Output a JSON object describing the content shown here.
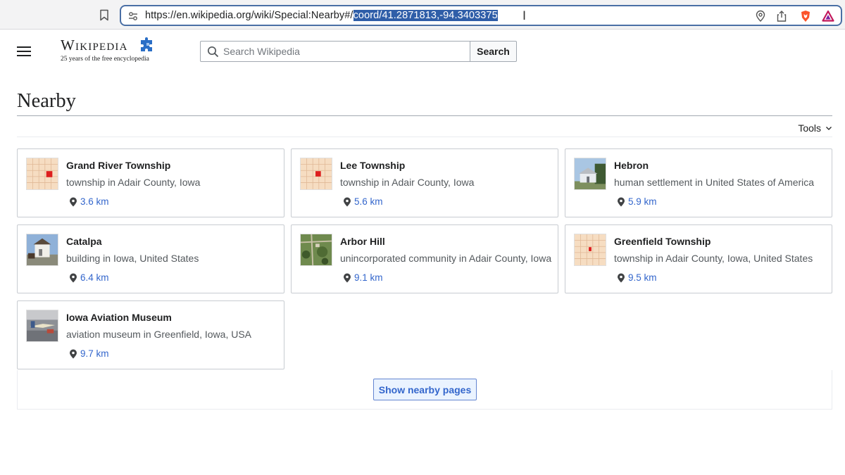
{
  "browser": {
    "url_prefix": "https://en.wikipedia.org/wiki/Special:Nearby#/",
    "url_selected": "coord/41.2871813,-94.3403375"
  },
  "header": {
    "logo_text": "Wikipedia",
    "tagline": "25 years of the free encyclopedia",
    "search_placeholder": "Search Wikipedia",
    "search_button": "Search"
  },
  "page": {
    "title": "Nearby",
    "tools_label": "Tools"
  },
  "cards": [
    {
      "title": "Grand River Township",
      "description": "township in Adair County, Iowa",
      "distance": "3.6 km",
      "thumb": "map-thumbnail"
    },
    {
      "title": "Lee Township",
      "description": "township in Adair County, Iowa",
      "distance": "5.6 km",
      "thumb": "map-thumbnail"
    },
    {
      "title": "Hebron",
      "description": "human settlement in United States of America",
      "distance": "5.9 km",
      "thumb": "photo-thumbnail"
    },
    {
      "title": "Catalpa",
      "description": "building in Iowa, United States",
      "distance": "6.4 km",
      "thumb": "photo-thumbnail"
    },
    {
      "title": "Arbor Hill",
      "description": "unincorporated community in Adair County, Iowa",
      "distance": "9.1 km",
      "thumb": "aerial-thumbnail"
    },
    {
      "title": "Greenfield Township",
      "description": "township in Adair County, Iowa, United States",
      "distance": "9.5 km",
      "thumb": "map-thumbnail"
    },
    {
      "title": "Iowa Aviation Museum",
      "description": "aviation museum in Greenfield, Iowa, USA",
      "distance": "9.7 km",
      "thumb": "photo-thumbnail"
    }
  ],
  "footer": {
    "show_button": "Show nearby pages"
  },
  "colors": {
    "link": "#3366cc",
    "selection": "#2f5ea8",
    "primary_button_bg": "#eaf3ff"
  }
}
